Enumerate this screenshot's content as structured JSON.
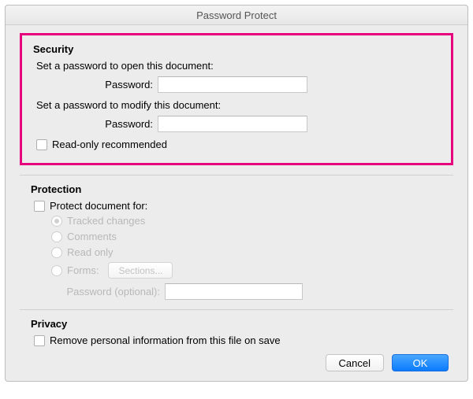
{
  "title": "Password Protect",
  "security": {
    "heading": "Security",
    "open_instruction": "Set a password to open this document:",
    "open_password_label": "Password:",
    "open_password_value": "",
    "modify_instruction": "Set a password to modify this document:",
    "modify_password_label": "Password:",
    "modify_password_value": "",
    "readonly_label": "Read-only recommended"
  },
  "protection": {
    "heading": "Protection",
    "protect_for_label": "Protect document for:",
    "tracked_changes": "Tracked changes",
    "comments": "Comments",
    "read_only": "Read only",
    "forms": "Forms:",
    "sections_btn": "Sections...",
    "password_optional_label": "Password (optional):",
    "password_optional_value": ""
  },
  "privacy": {
    "heading": "Privacy",
    "remove_personal_label": "Remove personal information from this file on save"
  },
  "buttons": {
    "cancel": "Cancel",
    "ok": "OK"
  }
}
